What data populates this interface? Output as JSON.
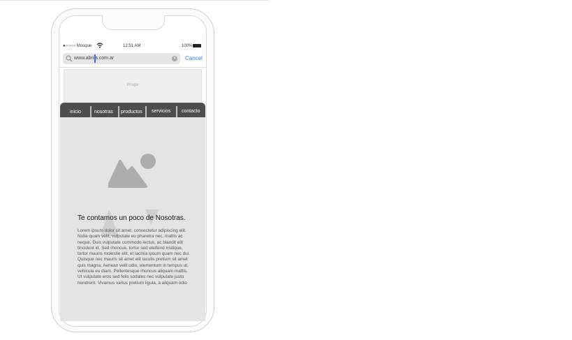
{
  "status_bar": {
    "carrier": "●○○○○ Mosque",
    "time": "12:51 AM",
    "battery": "100%"
  },
  "browser": {
    "url": "www.abrila.com.ar",
    "cancel_label": "Cancel"
  },
  "banner": {
    "placeholder": "Image"
  },
  "nav": {
    "items": [
      "inicio",
      "nosotras",
      "productos",
      "servicios",
      "contacto"
    ]
  },
  "main": {
    "title": "Te contamos un poco de Nosotras.",
    "lines": [
      "Lorem ipsum dolor sit amet, consectetur adipiscing elit.",
      "Nulla quam velit, vulputate eu pharetra nec, mattis ac",
      "neque. Duis vulputate commodo lectus, ac blandit elit",
      "tincidunt id. Sed rhoncus, tortor sed eleifend tristique,",
      "tortor mauris molestie elit, et lacinia ipsum quam nec dui.",
      "Quisque nec mauris sit amet elit iaculis pretium sit amet",
      "quis magna. Aenean velit odio, elementum in tempus ut,",
      "vehicula eu diam. Pellentesque rhoncus aliquam mattis.",
      "Ut vulputate eros sed felis sodales nec vulputate justo",
      "hendrerit. Vivamus varius pretium ligula, a aliquam odio"
    ]
  },
  "colors": {
    "nav_bg": "#4d4d4d",
    "content_bg": "#e4e4e4",
    "link": "#3b7be0"
  },
  "icons": [
    "wifi-icon",
    "battery-icon",
    "search-icon",
    "clear-icon",
    "image-placeholder-icon"
  ]
}
